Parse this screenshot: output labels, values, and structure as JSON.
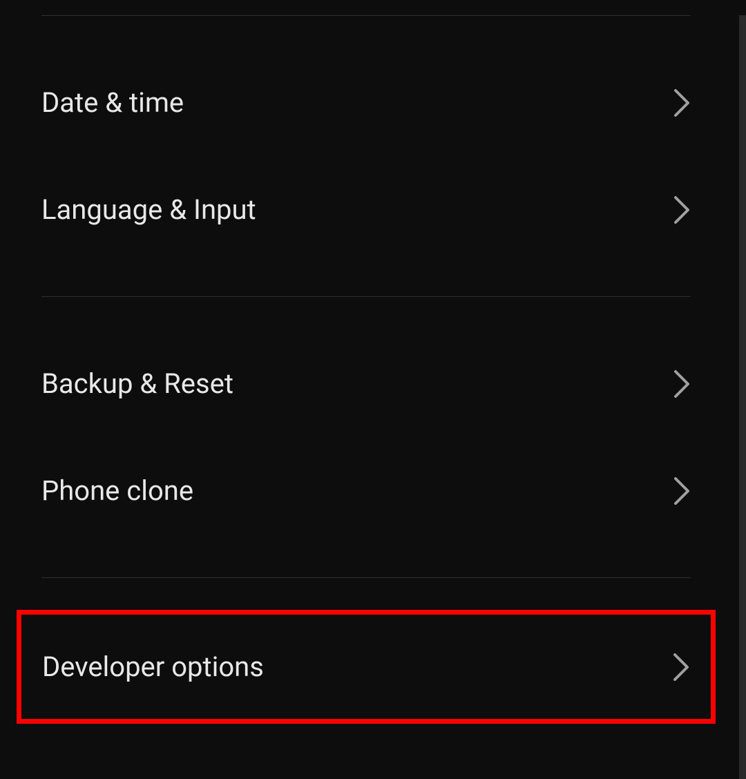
{
  "settings": {
    "items": [
      {
        "label": "Date & time"
      },
      {
        "label": "Language & Input"
      },
      {
        "label": "Backup & Reset"
      },
      {
        "label": "Phone clone"
      },
      {
        "label": "Developer options"
      }
    ]
  }
}
